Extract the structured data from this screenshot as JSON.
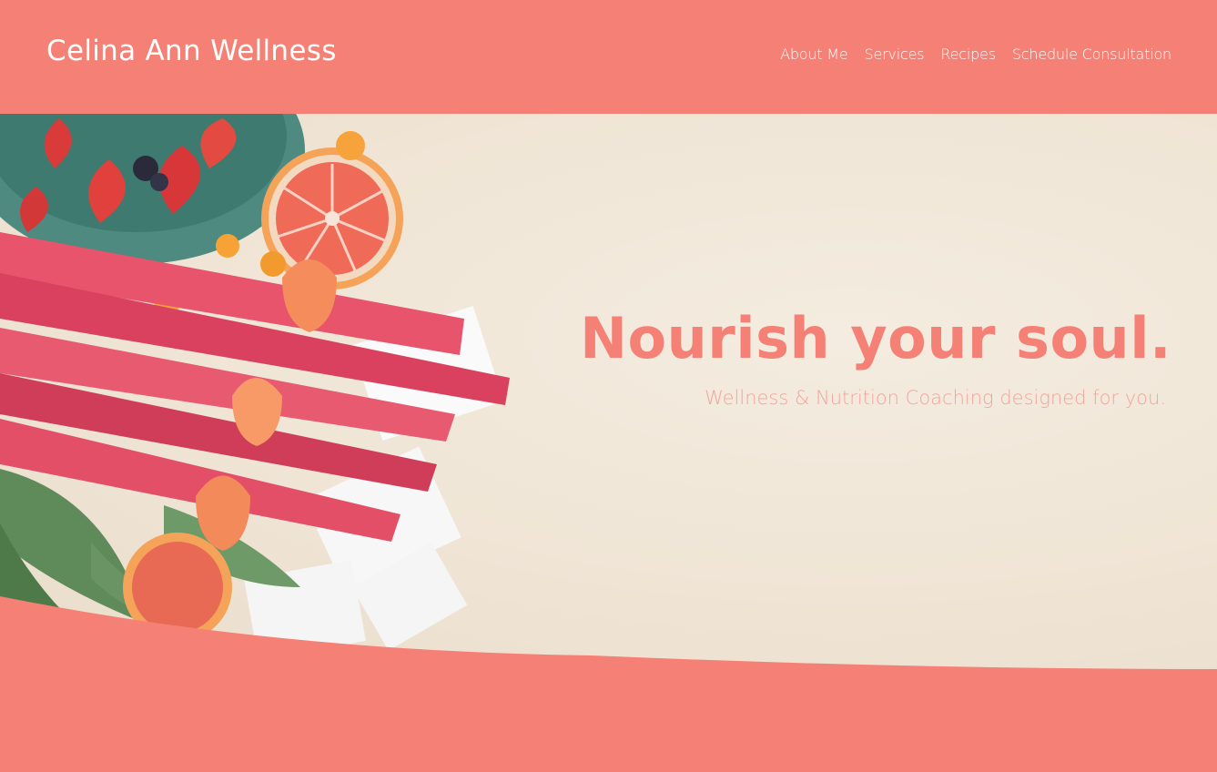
{
  "site": {
    "title": "Celina Ann Wellness"
  },
  "nav": {
    "items": [
      {
        "label": "About Me"
      },
      {
        "label": "Services"
      },
      {
        "label": "Recipes"
      },
      {
        "label": "Schedule Consultation"
      }
    ]
  },
  "hero": {
    "headline": "Nourish your soul.",
    "subheadline": "Wellness & Nutrition Coaching designed for you."
  },
  "colors": {
    "brand_coral": "#f58075",
    "hero_background": "#efe4d4",
    "subheadline": "#f5a39c",
    "text_on_brand": "#ffffff"
  }
}
